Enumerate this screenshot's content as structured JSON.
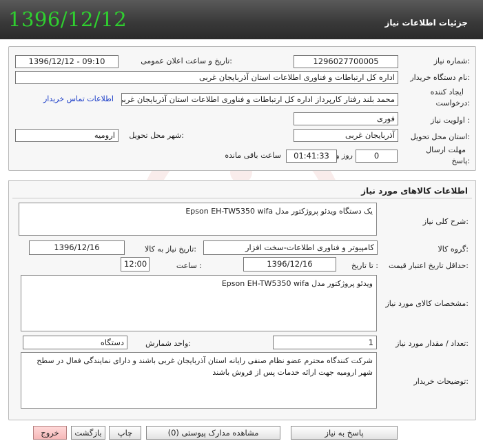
{
  "header": {
    "date": "1396/12/12",
    "title": "جزئیات اطلاعات نیاز"
  },
  "info": {
    "need_number_label": "شماره نیاز:",
    "need_number": "1296027700005",
    "announce_label": "تاریخ و ساعت اعلان عمومی:",
    "announce_value": "1396/12/12 - 09:10",
    "buyer_org_label": "نام دستگاه خریدار:",
    "buyer_org": "اداره کل ارتباطات و فناوری اطلاعات استان آذربایجان غربی",
    "creator_label_1": "ایجاد کننده",
    "creator_label_2": "درخواست:",
    "creator": "محمد بلند رفتار کارپرداز اداره کل ارتباطات و فناوری اطلاعات استان آذربایجان غربی",
    "contact_link": "اطلاعات تماس خریدار",
    "priority_label": "اولویت نیاز :",
    "priority": "فوری",
    "province_label": "استان محل تحویل:",
    "province": "آذربایجان غربی",
    "city_label": "شهر محل تحویل:",
    "city": "ارومیه",
    "deadline_label_1": "مهلت ارسال",
    "deadline_label_2": "پاسخ:",
    "days_value": "0",
    "days_label": "روز و",
    "time_value": "01:41:33",
    "remaining_label": "ساعت باقی مانده"
  },
  "goods": {
    "section_title": "اطلاعات کالاهای مورد نیاز",
    "summary_label": "شرح کلی نیاز:",
    "summary": "یک دستگاه ویدئو پروژکتور مدل Epson EH-TW5350 wifa",
    "group_label": "گروه کالا:",
    "group": "کامپیوتر و فناوری اطلاعات-سخت افزار",
    "need_date_label": "تاریخ نیاز به کالا:",
    "need_date": "1396/12/16",
    "min_validity_label": "حداقل تاریخ اعتبار قیمت:",
    "to_date_label": "تا تاریخ :",
    "to_date": "1396/12/16",
    "hour_label": "ساعت :",
    "hour": "12:00",
    "specs_label": "مشخصات کالای مورد نیاز:",
    "specs": "ویدئو پروژکتور مدل Epson EH-TW5350 wifa",
    "quantity_label": "تعداد / مقدار مورد نیاز:",
    "quantity": "1",
    "unit_label": "واحد شمارش:",
    "unit": "دستگاه",
    "buyer_notes_label": "توضیحات خریدار:",
    "buyer_notes": "شرکت کنندگاه محترم عضو نظام صنفی رایانه استان آذربایجان غربی باشند و دارای نمایندگی فعال در سطح شهر ارومیه جهت ارائه خدمات پس از فروش باشند"
  },
  "footer": {
    "reply": "پاسخ به نیاز",
    "attachments": "مشاهده مدارک پیوستی (0)",
    "print": "چاپ",
    "back": "بازگشت",
    "exit": "خروج"
  },
  "colors": {
    "header_date": "#2fd02f",
    "link": "#1a3cc8",
    "exit_button": "#f6b8b8"
  }
}
